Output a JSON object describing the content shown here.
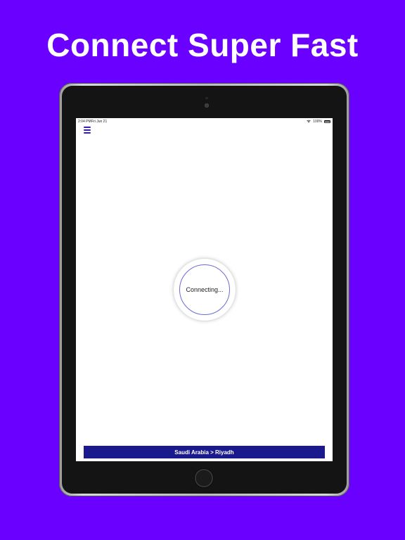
{
  "headline": "Connect Super Fast",
  "statusbar": {
    "time": "2:04 PM",
    "date": "Fri Jun 21",
    "battery": "100%"
  },
  "icons": {
    "menu": "hamburger-menu-icon",
    "wifi": "wifi-icon",
    "battery": "battery-icon"
  },
  "connect": {
    "status_label": "Connecting..."
  },
  "location": {
    "label": "Saudi Arabia > Riyadh"
  },
  "colors": {
    "background": "#6a00ff",
    "menu_accent": "#3a1bb0",
    "location_bar": "#1a1a8c",
    "ring": "#6a6ad8"
  }
}
